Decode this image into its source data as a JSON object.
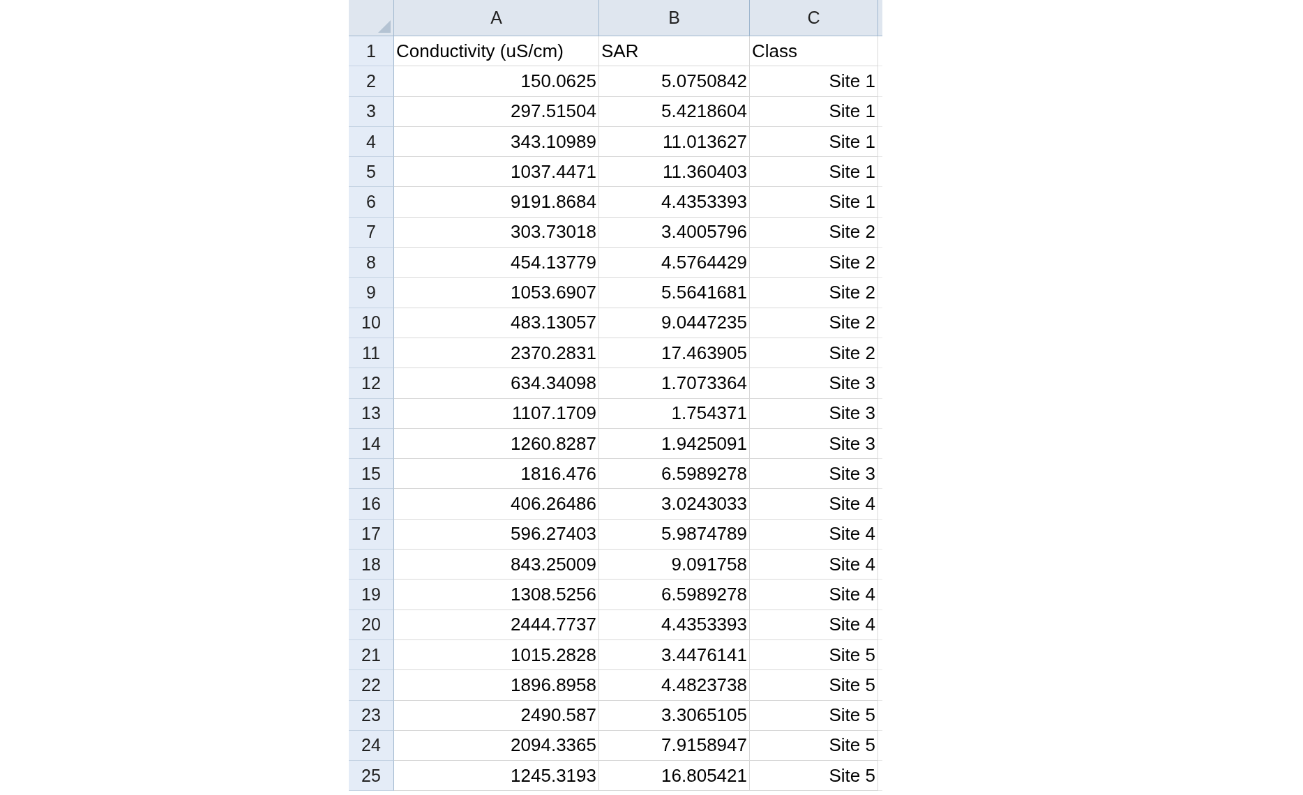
{
  "columns": [
    "A",
    "B",
    "C"
  ],
  "rows": [
    {
      "number": "1",
      "cells": [
        "Conductivity (uS/cm)",
        "SAR",
        "Class"
      ],
      "kind": "text"
    },
    {
      "number": "2",
      "cells": [
        "150.0625",
        "5.0750842",
        "Site 1"
      ],
      "kind": "value"
    },
    {
      "number": "3",
      "cells": [
        "297.51504",
        "5.4218604",
        "Site 1"
      ],
      "kind": "value"
    },
    {
      "number": "4",
      "cells": [
        "343.10989",
        "11.013627",
        "Site 1"
      ],
      "kind": "value"
    },
    {
      "number": "5",
      "cells": [
        "1037.4471",
        "11.360403",
        "Site 1"
      ],
      "kind": "value"
    },
    {
      "number": "6",
      "cells": [
        "9191.8684",
        "4.4353393",
        "Site 1"
      ],
      "kind": "value"
    },
    {
      "number": "7",
      "cells": [
        "303.73018",
        "3.4005796",
        "Site 2"
      ],
      "kind": "value"
    },
    {
      "number": "8",
      "cells": [
        "454.13779",
        "4.5764429",
        "Site 2"
      ],
      "kind": "value"
    },
    {
      "number": "9",
      "cells": [
        "1053.6907",
        "5.5641681",
        "Site 2"
      ],
      "kind": "value"
    },
    {
      "number": "10",
      "cells": [
        "483.13057",
        "9.0447235",
        "Site 2"
      ],
      "kind": "value"
    },
    {
      "number": "11",
      "cells": [
        "2370.2831",
        "17.463905",
        "Site 2"
      ],
      "kind": "value"
    },
    {
      "number": "12",
      "cells": [
        "634.34098",
        "1.7073364",
        "Site 3"
      ],
      "kind": "value"
    },
    {
      "number": "13",
      "cells": [
        "1107.1709",
        "1.754371",
        "Site 3"
      ],
      "kind": "value"
    },
    {
      "number": "14",
      "cells": [
        "1260.8287",
        "1.9425091",
        "Site 3"
      ],
      "kind": "value"
    },
    {
      "number": "15",
      "cells": [
        "1816.476",
        "6.5989278",
        "Site 3"
      ],
      "kind": "value"
    },
    {
      "number": "16",
      "cells": [
        "406.26486",
        "3.0243033",
        "Site 4"
      ],
      "kind": "value"
    },
    {
      "number": "17",
      "cells": [
        "596.27403",
        "5.9874789",
        "Site 4"
      ],
      "kind": "value"
    },
    {
      "number": "18",
      "cells": [
        "843.25009",
        "9.091758",
        "Site 4"
      ],
      "kind": "value"
    },
    {
      "number": "19",
      "cells": [
        "1308.5256",
        "6.5989278",
        "Site 4"
      ],
      "kind": "value"
    },
    {
      "number": "20",
      "cells": [
        "2444.7737",
        "4.4353393",
        "Site 4"
      ],
      "kind": "value"
    },
    {
      "number": "21",
      "cells": [
        "1015.2828",
        "3.4476141",
        "Site 5"
      ],
      "kind": "value"
    },
    {
      "number": "22",
      "cells": [
        "1896.8958",
        "4.4823738",
        "Site 5"
      ],
      "kind": "value"
    },
    {
      "number": "23",
      "cells": [
        "2490.587",
        "3.3065105",
        "Site 5"
      ],
      "kind": "value"
    },
    {
      "number": "24",
      "cells": [
        "2094.3365",
        "7.9158947",
        "Site 5"
      ],
      "kind": "value"
    },
    {
      "number": "25",
      "cells": [
        "1245.3193",
        "16.805421",
        "Site 5"
      ],
      "kind": "value"
    }
  ]
}
